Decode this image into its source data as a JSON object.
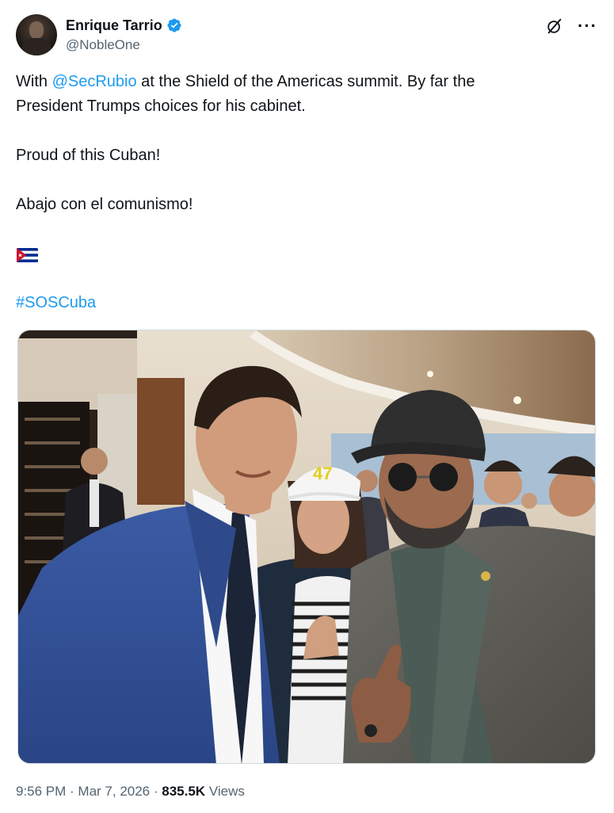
{
  "author": {
    "display_name": "Enrique Tarrio",
    "handle": "@NobleOne",
    "verified": true,
    "avatar_icon": "avatar-image"
  },
  "actions": {
    "grok_icon": "grok-icon",
    "more_icon": "more-options-icon",
    "more_glyph": "···"
  },
  "post": {
    "line1_prefix": "With ",
    "mention": "@SecRubio",
    "line1_suffix": " at the Shield of the Americas summit. By far the",
    "line2": "President Trumps choices for his cabinet.",
    "paragraph2": "Proud of this Cuban!",
    "paragraph3": "Abajo con el comunismo!",
    "flag_emoji": "cuba-flag",
    "hashtag": "#SOSCuba"
  },
  "photo": {
    "cap_text": "47"
  },
  "meta": {
    "time": "9:56 PM",
    "separator": " · ",
    "date": "Mar 7, 2026",
    "views_count": "835.5K",
    "views_label": " Views"
  },
  "colors": {
    "link": "#1d9bf0",
    "secondary_text": "#536471",
    "primary_text": "#0f1419",
    "verified_badge": "#1d9bf0"
  }
}
